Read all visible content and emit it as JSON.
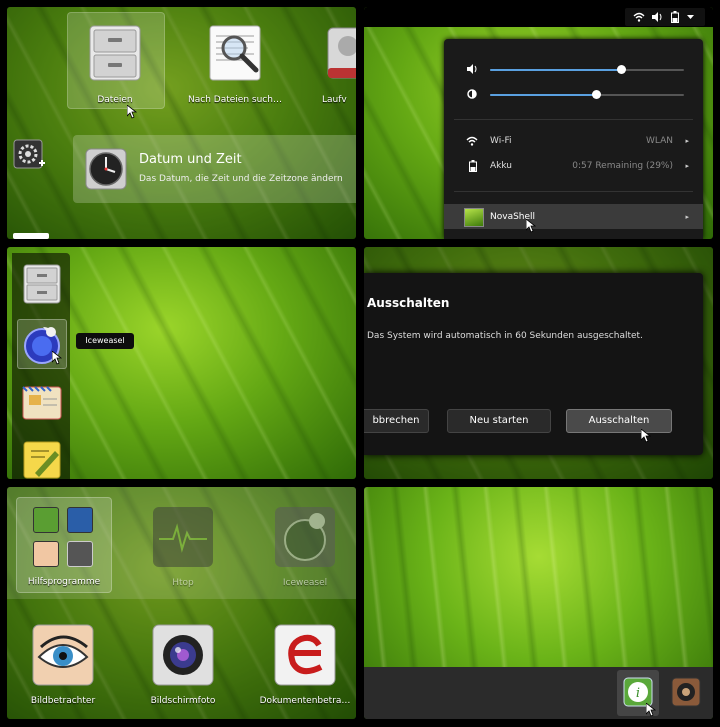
{
  "panel_apps": {
    "apps": [
      {
        "label": "Dateien",
        "icon": "file-cabinet-icon"
      },
      {
        "label": "Nach Dateien such…",
        "icon": "search-files-icon"
      },
      {
        "label": "Laufv",
        "icon": "disk-icon"
      }
    ],
    "settings_result": {
      "title": "Datum und Zeit",
      "subtitle": "Das Datum, die Zeit und die Zeitzone ändern",
      "icon": "clock-icon"
    }
  },
  "panel_system_menu": {
    "topbar_icons": [
      "wifi-icon",
      "volume-icon",
      "battery-icon",
      "chevron-down-icon"
    ],
    "volume_level": 0.68,
    "brightness_level": 0.55,
    "rows": [
      {
        "label": "Wi-Fi",
        "value": "WLAN",
        "icon": "wifi-icon"
      },
      {
        "label": "Akku",
        "value": "0:57 Remaining (29%)",
        "icon": "battery-icon"
      }
    ],
    "user": {
      "label": "NovaShell",
      "icon": "avatar"
    }
  },
  "panel_dash": {
    "items": [
      "file-cabinet-icon",
      "iceweasel-icon",
      "mail-icon",
      "notes-icon"
    ],
    "tooltip": "Iceweasel"
  },
  "panel_dialog": {
    "title": "Ausschalten",
    "message": "Das System wird automatisch in 60 Sekunden ausgeschaltet.",
    "buttons": {
      "cancel": "bbrechen",
      "restart": "Neu starten",
      "shutdown": "Ausschalten"
    }
  },
  "panel_app_grid": {
    "row1": [
      {
        "label": "Hilfsprogramme"
      },
      {
        "label": "Htop"
      },
      {
        "label": "Iceweasel"
      }
    ],
    "row2": [
      {
        "label": "Bildbetrachter"
      },
      {
        "label": "Bildschirmfoto"
      },
      {
        "label": "Dokumentenbetra…"
      }
    ]
  },
  "panel_tray": {
    "icons": [
      "info-icon",
      "speaker-icon"
    ]
  },
  "colors": {
    "accent": "#5aa0e0",
    "leaf_green": "#6ab318",
    "menu_bg": "#1a1a1a"
  }
}
